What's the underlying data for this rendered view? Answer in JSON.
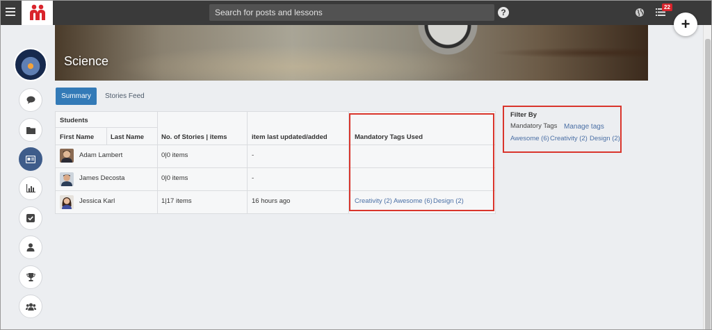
{
  "search": {
    "placeholder": "Search for posts and lessons"
  },
  "topbar": {
    "help_glyph": "?",
    "notification_count": "22",
    "add_glyph": "+"
  },
  "banner": {
    "title": "Science"
  },
  "tabs": [
    {
      "label": "Summary",
      "active": true
    },
    {
      "label": "Stories Feed",
      "active": false
    }
  ],
  "table": {
    "group_header": "Students",
    "headers": {
      "first_name": "First Name",
      "last_name": "Last Name",
      "stories": "No. of Stories | items",
      "updated": "item last updated/added",
      "tags": "Mandatory Tags Used"
    },
    "rows": [
      {
        "name": "Adam Lambert",
        "stories": "0|0 items",
        "updated": "-",
        "tags": []
      },
      {
        "name": "James Decosta",
        "stories": "0|0 items",
        "updated": "-",
        "tags": []
      },
      {
        "name": "Jessica Karl",
        "stories": "1|17 items",
        "updated": "16 hours ago",
        "tags": [
          "Creativity (2)",
          "Awesome (6)",
          "Design (2)"
        ]
      }
    ]
  },
  "filter": {
    "title": "Filter By",
    "subtitle": "Mandatory Tags",
    "manage_label": "Manage tags",
    "tags": [
      "Awesome (6)",
      "Creativity (2)",
      "Design (2)"
    ]
  },
  "sidenav": [
    {
      "icon": "chat-bubble-icon",
      "active": false
    },
    {
      "icon": "folder-icon",
      "active": false
    },
    {
      "icon": "id-card-icon",
      "active": true
    },
    {
      "icon": "bar-chart-icon",
      "active": false
    },
    {
      "icon": "checkbox-icon",
      "active": false
    },
    {
      "icon": "user-icon",
      "active": false
    },
    {
      "icon": "trophy-icon",
      "active": false
    },
    {
      "icon": "group-icon",
      "active": false
    }
  ],
  "colors": {
    "topbar": "#3a3a3a",
    "brand": "#d9242c",
    "accent": "#337ab7",
    "nav_active": "#3e5c8a",
    "highlight_box": "#d9342b",
    "link": "#4a6fa5"
  }
}
